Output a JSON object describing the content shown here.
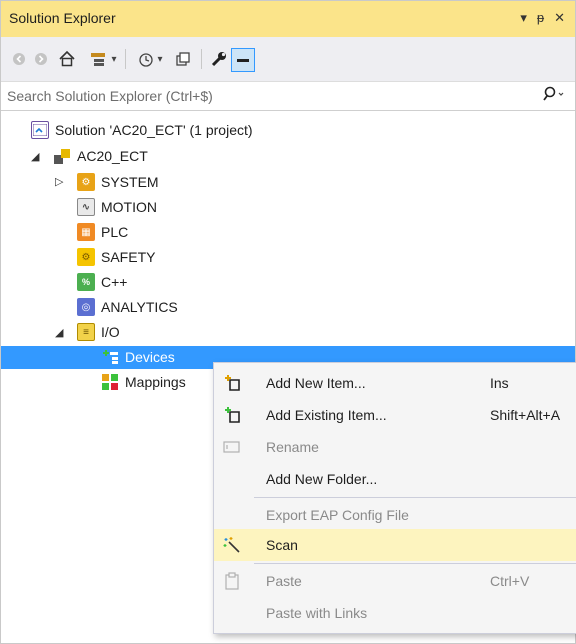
{
  "window": {
    "title": "Solution Explorer"
  },
  "title_icons": {
    "dropdown": "▾",
    "pin": "ᵽ",
    "close": "✕"
  },
  "toolbar": {
    "buttons": [
      "back-icon",
      "forward-icon",
      "home-icon",
      "switch-views-icon",
      "history-icon",
      "collapse-all-icon",
      "properties-wrench-icon",
      "preview-icon"
    ]
  },
  "search": {
    "placeholder": "Search Solution Explorer (Ctrl+$)"
  },
  "tree": {
    "solution": "Solution 'AC20_ECT' (1 project)",
    "project": "AC20_ECT",
    "system": "SYSTEM",
    "motion": "MOTION",
    "plc": "PLC",
    "safety": "SAFETY",
    "cpp": "C++",
    "analytics": "ANALYTICS",
    "io": "I/O",
    "devices": "Devices",
    "mappings": "Mappings"
  },
  "context_menu": {
    "add_new_item": {
      "label": "Add New Item...",
      "shortcut": "Ins"
    },
    "add_existing_item": {
      "label": "Add Existing Item...",
      "shortcut": "Shift+Alt+A"
    },
    "rename": {
      "label": "Rename"
    },
    "add_new_folder": {
      "label": "Add New Folder..."
    },
    "export_eap": {
      "label": "Export EAP Config File"
    },
    "scan": {
      "label": "Scan"
    },
    "paste": {
      "label": "Paste",
      "shortcut": "Ctrl+V"
    },
    "paste_with_links": {
      "label": "Paste with Links"
    }
  },
  "colors": {
    "title_bar": "#fbe48a",
    "selection": "#3399ff",
    "menu_hover": "#fdf4bf"
  }
}
